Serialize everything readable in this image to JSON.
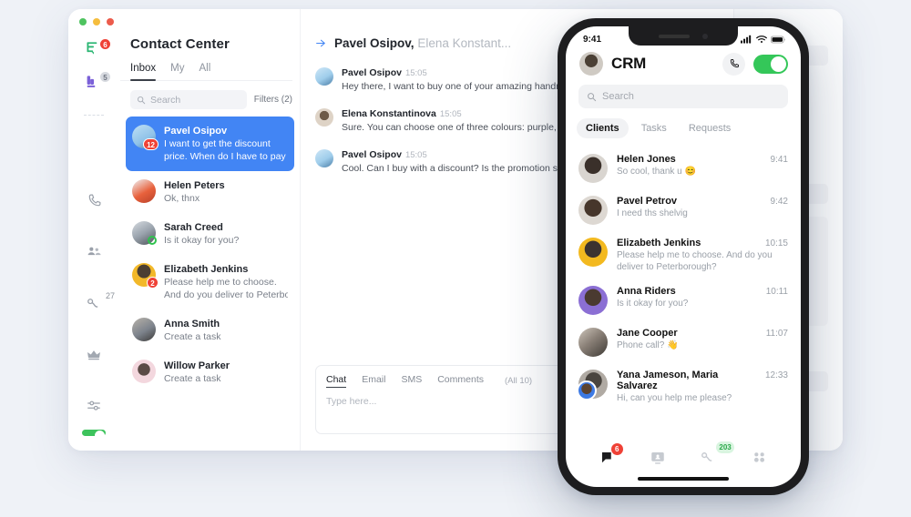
{
  "desktop": {
    "window_controls": [
      "close",
      "minimize",
      "maximize"
    ],
    "rail": [
      {
        "name": "chat-rail-icon",
        "badge": "6",
        "badge_style": "red"
      },
      {
        "name": "deals-rail-icon",
        "badge": "5",
        "badge_style": "grey"
      },
      {
        "name": "calls-rail-icon",
        "badge": "",
        "badge_style": "none"
      },
      {
        "name": "contacts-rail-icon",
        "badge": "",
        "badge_style": "none"
      },
      {
        "name": "analytics-rail-icon",
        "badge": "27",
        "badge_style": "sup"
      },
      {
        "name": "crown-rail-icon",
        "badge": "",
        "badge_style": "none"
      },
      {
        "name": "settings-rail-icon",
        "badge": "",
        "badge_style": "none"
      }
    ],
    "rail_toggle_on": true,
    "list": {
      "title": "Contact Center",
      "tabs": [
        {
          "label": "Inbox",
          "active": true
        },
        {
          "label": "My",
          "active": false
        },
        {
          "label": "All",
          "active": false
        }
      ],
      "search_placeholder": "Search",
      "filters_label": "Filters (2)",
      "conversations": [
        {
          "name": "Pavel Osipov",
          "preview_line1": "I want to get the discount",
          "preview_line2": "price. When do I have to pay",
          "badge": "12",
          "badge_type": "count",
          "selected": true,
          "avatar_color": "#8fc2e8"
        },
        {
          "name": "Helen Peters",
          "preview_line1": "Ok, thnx",
          "preview_line2": "",
          "badge": "",
          "badge_type": "none",
          "selected": false,
          "avatar_color": "#e8613c"
        },
        {
          "name": "Sarah Creed",
          "preview_line1": "Is it okay for you?",
          "preview_line2": "",
          "badge": "",
          "badge_type": "online",
          "selected": false,
          "avatar_color": "#9aa3ad"
        },
        {
          "name": "Elizabeth Jenkins",
          "preview_line1": "Please help me to choose.",
          "preview_line2": "And do you deliver to Peterbo",
          "badge": "2",
          "badge_type": "count",
          "selected": false,
          "avatar_color": "#f2b829"
        },
        {
          "name": "Anna Smith",
          "preview_line1": "Create a task",
          "preview_line2": "",
          "badge": "",
          "badge_type": "none",
          "selected": false,
          "avatar_color": "#7d838c"
        },
        {
          "name": "Willow Parker",
          "preview_line1": "Create a task",
          "preview_line2": "",
          "badge": "",
          "badge_type": "none",
          "selected": false,
          "avatar_color": "#f3d7de"
        }
      ]
    },
    "chat": {
      "title_primary": "Pavel Osipov,",
      "title_secondary": "Elena Konstant...",
      "actions": [
        {
          "name": "forward-icon",
          "color": "#29b24a"
        },
        {
          "name": "block-icon",
          "color": "#e8403a"
        }
      ],
      "messages": [
        {
          "author": "Pavel Osipov",
          "time": "15:05",
          "text": "Hey there, I want to buy one of your amazing handmade knives",
          "avatar_color": "#9fcdeb"
        },
        {
          "author": "Elena Konstantinova",
          "time": "15:05",
          "text": "Sure. You can choose one of three colours: purple, green and cranberry red.",
          "avatar_color": "#ded3c6"
        },
        {
          "author": "Pavel Osipov",
          "time": "15:05",
          "text": "Cool. Can I buy with a discount? Is the promotion still on?",
          "avatar_color": "#9fcdeb"
        }
      ],
      "composer": {
        "tabs": [
          {
            "label": "Chat",
            "active": true
          },
          {
            "label": "Email",
            "active": false
          },
          {
            "label": "SMS",
            "active": false
          },
          {
            "label": "Comments",
            "active": false
          }
        ],
        "all_label": "(All 10)",
        "placeholder": "Type here...",
        "tools": [
          {
            "name": "translate-icon"
          },
          {
            "name": "attachment-icon"
          },
          {
            "name": "emoji-icon"
          }
        ]
      }
    },
    "right_panel": {
      "collapse_rows": 3,
      "edit_rows": 2
    }
  },
  "phone": {
    "status": {
      "time": "9:41",
      "signal": "signal-icon",
      "wifi": "wifi-icon",
      "battery": "battery-icon"
    },
    "header": {
      "title": "CRM",
      "avatar": "user-avatar",
      "call_icon": "phone-icon",
      "toggle_on": true
    },
    "search_placeholder": "Search",
    "tabs": [
      {
        "label": "Clients",
        "active": true
      },
      {
        "label": "Tasks",
        "active": false
      },
      {
        "label": "Requests",
        "active": false
      }
    ],
    "rows": [
      {
        "name": "Helen Jones",
        "time": "9:41",
        "message": "So cool, thank u 😊",
        "avatar_color": "#d9d5d0",
        "second_avatar": false
      },
      {
        "name": "Pavel Petrov",
        "time": "9:42",
        "message": "I need ths shelvig",
        "avatar_color": "#ddd8d2",
        "second_avatar": false
      },
      {
        "name": "Elizabeth Jenkins",
        "time": "10:15",
        "message": "Please help me to choose. And do you deliver to Peterborough?",
        "avatar_color": "#f3b91f",
        "second_avatar": false
      },
      {
        "name": "Anna Riders",
        "time": "10:11",
        "message": "Is it okay for you?",
        "avatar_color": "#8b6fd4",
        "second_avatar": false
      },
      {
        "name": "Jane Cooper",
        "time": "11:07",
        "message": "Phone call? 👋",
        "avatar_color": "#8a8077",
        "second_avatar": false
      },
      {
        "name": "Yana Jameson, Maria Salvarez",
        "time": "12:33",
        "message": "Hi, can you help me please?",
        "avatar_color": "#b0aaa3",
        "second_avatar": true
      }
    ],
    "tabbar": [
      {
        "name": "chats-tab-icon",
        "badge": "6",
        "badge_style": "red"
      },
      {
        "name": "desktop-tab-icon",
        "badge": "",
        "badge_style": "none"
      },
      {
        "name": "analytics-tab-icon",
        "badge": "203",
        "badge_style": "green"
      },
      {
        "name": "contacts-tab-icon",
        "badge": "",
        "badge_style": "none"
      }
    ]
  },
  "colors": {
    "page_background": "#eff2f7",
    "accent_blue": "#4285f4",
    "badge_red": "#ef4136",
    "toggle_green": "#3dc35c",
    "ios_green": "#34c759",
    "badge_green_bg": "#d9f5e0"
  }
}
